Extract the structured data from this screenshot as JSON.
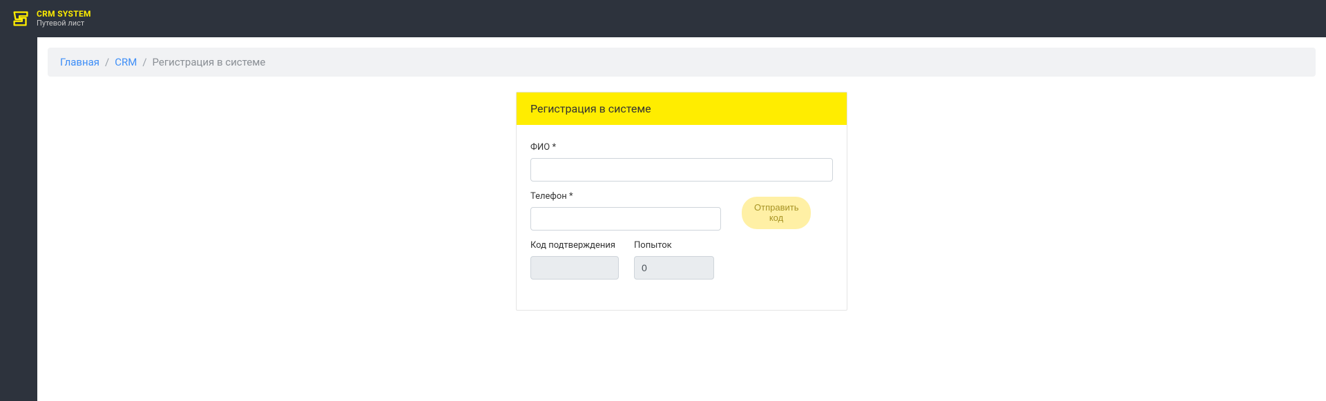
{
  "header": {
    "logo_title": "CRM SYSTEM",
    "logo_subtitle": "Путевой лист"
  },
  "breadcrumb": {
    "home": "Главная",
    "crm": "CRM",
    "current": "Регистрация в системе"
  },
  "form": {
    "title": "Регистрация в системе",
    "fio_label": "ФИО *",
    "fio_value": "",
    "phone_label": "Телефон *",
    "phone_value": "",
    "send_code_label": "Отправить код",
    "code_label": "Код подтверждения",
    "code_value": "",
    "attempts_label": "Попыток",
    "attempts_value": "0"
  }
}
